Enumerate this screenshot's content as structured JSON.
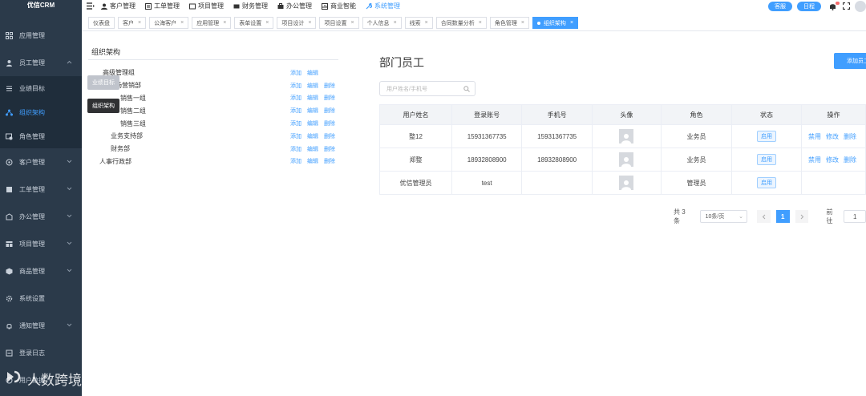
{
  "app": {
    "name": "优信CRM"
  },
  "sidebar": {
    "items": [
      {
        "label": "应用管理",
        "icon": "grid-icon",
        "has_chevron": false
      },
      {
        "label": "员工管理",
        "icon": "user-icon",
        "has_chevron": true,
        "expanded": true
      },
      {
        "label": "客户管理",
        "icon": "customer-icon",
        "has_chevron": true
      },
      {
        "label": "工单管理",
        "icon": "ticket-icon",
        "has_chevron": true
      },
      {
        "label": "办公管理",
        "icon": "office-icon",
        "has_chevron": true
      },
      {
        "label": "项目管理",
        "icon": "project-icon",
        "has_chevron": true
      },
      {
        "label": "商品管理",
        "icon": "goods-icon",
        "has_chevron": true
      },
      {
        "label": "系统设置",
        "icon": "gear-icon",
        "has_chevron": false
      },
      {
        "label": "通知管理",
        "icon": "bell-icon",
        "has_chevron": true
      },
      {
        "label": "登录日志",
        "icon": "log-icon",
        "has_chevron": false
      },
      {
        "label": "用户数据",
        "icon": "data-icon",
        "has_chevron": false
      }
    ],
    "subitems": [
      {
        "label": "业绩目标",
        "active": false
      },
      {
        "label": "组织架构",
        "active": true
      },
      {
        "label": "角色管理",
        "active": false
      }
    ]
  },
  "topnav": {
    "items": [
      {
        "label": "客户管理",
        "active": false
      },
      {
        "label": "工单管理",
        "active": false
      },
      {
        "label": "项目管理",
        "active": false
      },
      {
        "label": "财务管理",
        "active": false
      },
      {
        "label": "办公管理",
        "active": false
      },
      {
        "label": "商业智能",
        "active": false
      },
      {
        "label": "系统管理",
        "active": true
      }
    ],
    "service_label": "客服",
    "schedule_label": "日程"
  },
  "tags": [
    {
      "label": "仪表盘",
      "closable": false,
      "active": false
    },
    {
      "label": "客户",
      "closable": true,
      "active": false
    },
    {
      "label": "公海客户",
      "closable": true,
      "active": false
    },
    {
      "label": "应用管理",
      "closable": true,
      "active": false
    },
    {
      "label": "表单设置",
      "closable": true,
      "active": false
    },
    {
      "label": "项目设计",
      "closable": true,
      "active": false
    },
    {
      "label": "项目设置",
      "closable": true,
      "active": false
    },
    {
      "label": "个人信息",
      "closable": true,
      "active": false
    },
    {
      "label": "线索",
      "closable": true,
      "active": false
    },
    {
      "label": "合同数量分析",
      "closable": true,
      "active": false
    },
    {
      "label": "角色管理",
      "closable": true,
      "active": false
    },
    {
      "label": "组织架构",
      "closable": true,
      "active": true
    }
  ],
  "org": {
    "title": "组织架构",
    "ops": {
      "add": "添加",
      "edit": "编辑",
      "delete": "删除"
    },
    "nodes": [
      {
        "label": "高级管理组",
        "level": 0,
        "arrow": false,
        "ops": [
          "添加",
          "编辑"
        ]
      },
      {
        "label": "市场营销部",
        "level": 1,
        "arrow": true,
        "ops": [
          "添加",
          "编辑",
          "删除"
        ]
      },
      {
        "label": "销售一组",
        "level": 2,
        "arrow": false,
        "ops": [
          "添加",
          "编辑",
          "删除"
        ]
      },
      {
        "label": "销售二组",
        "level": 2,
        "arrow": false,
        "ops": [
          "添加",
          "编辑",
          "删除"
        ]
      },
      {
        "label": "销售三组",
        "level": 2,
        "arrow": false,
        "ops": [
          "添加",
          "编辑",
          "删除"
        ]
      },
      {
        "label": "业务支持部",
        "level": 1,
        "arrow": false,
        "ops": [
          "添加",
          "编辑",
          "删除"
        ]
      },
      {
        "label": "财务部",
        "level": 1,
        "arrow": false,
        "ops": [
          "添加",
          "编辑",
          "删除"
        ]
      },
      {
        "label": "人事行政部",
        "level": 1,
        "arrow": false,
        "ops": [
          "添加",
          "编辑",
          "删除"
        ]
      }
    ]
  },
  "tooltips": {
    "target": "业绩目标",
    "org": "组织架构"
  },
  "dept": {
    "title": "部门员工",
    "add_button": "添加员工",
    "search_placeholder": "用户姓名/手机号",
    "columns": [
      "用户姓名",
      "登录账号",
      "手机号",
      "头像",
      "角色",
      "状态",
      "操作"
    ],
    "rows": [
      {
        "name": "整12",
        "account": "15931367735",
        "phone": "15931367735",
        "role": "业务员",
        "status": "启用",
        "ops": [
          "禁用",
          "修改",
          "删除"
        ]
      },
      {
        "name": "郑整",
        "account": "18932808900",
        "phone": "18932808900",
        "role": "业务员",
        "status": "启用",
        "ops": [
          "禁用",
          "修改",
          "删除"
        ]
      },
      {
        "name": "优信管理员",
        "account": "test",
        "phone": "",
        "role": "管理员",
        "status": "启用",
        "ops": []
      }
    ]
  },
  "pagination": {
    "total": "共 3 条",
    "page_size": "10条/页",
    "current_page": "1",
    "goto_label": "前往",
    "goto_value": "1"
  },
  "watermark": "人数跨境"
}
